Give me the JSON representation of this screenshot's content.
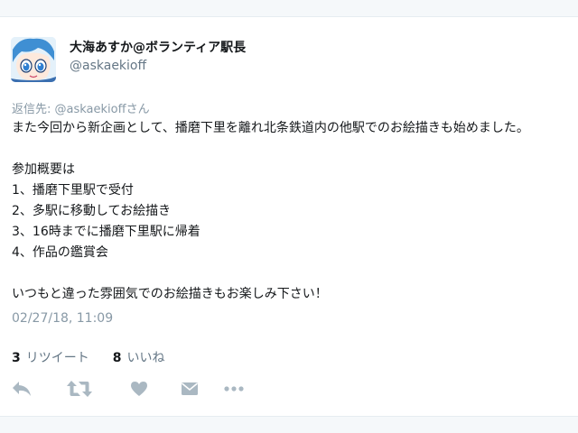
{
  "tweet": {
    "display_name": "大海あすか@ボランティア駅長",
    "handle": "@askaekioff",
    "reply_to": "返信先: @askaekioffさん",
    "text": "また今回から新企画として、播磨下里を離れ北条鉄道内の他駅でのお絵描きも始めました。\n\n参加概要は\n1、播磨下里駅で受付\n2、多駅に移動してお絵描き\n3、16時までに播磨下里駅に帰着\n4、作品の鑑賞会\n\nいつもと違った雰囲気でのお絵描きもお楽しみ下さい！",
    "timestamp": "02/27/18, 11:09",
    "retweets": {
      "count": "3",
      "label": "リツイート"
    },
    "likes": {
      "count": "8",
      "label": "いいね"
    }
  },
  "actions": [
    {
      "name": "reply-icon"
    },
    {
      "name": "retweet-icon"
    },
    {
      "name": "like-icon"
    },
    {
      "name": "direct-message-icon"
    },
    {
      "name": "more-icon"
    }
  ],
  "colors": {
    "icon_gray": "#aab8c2",
    "secondary_text": "#8899a6",
    "primary_text": "#14171a"
  }
}
